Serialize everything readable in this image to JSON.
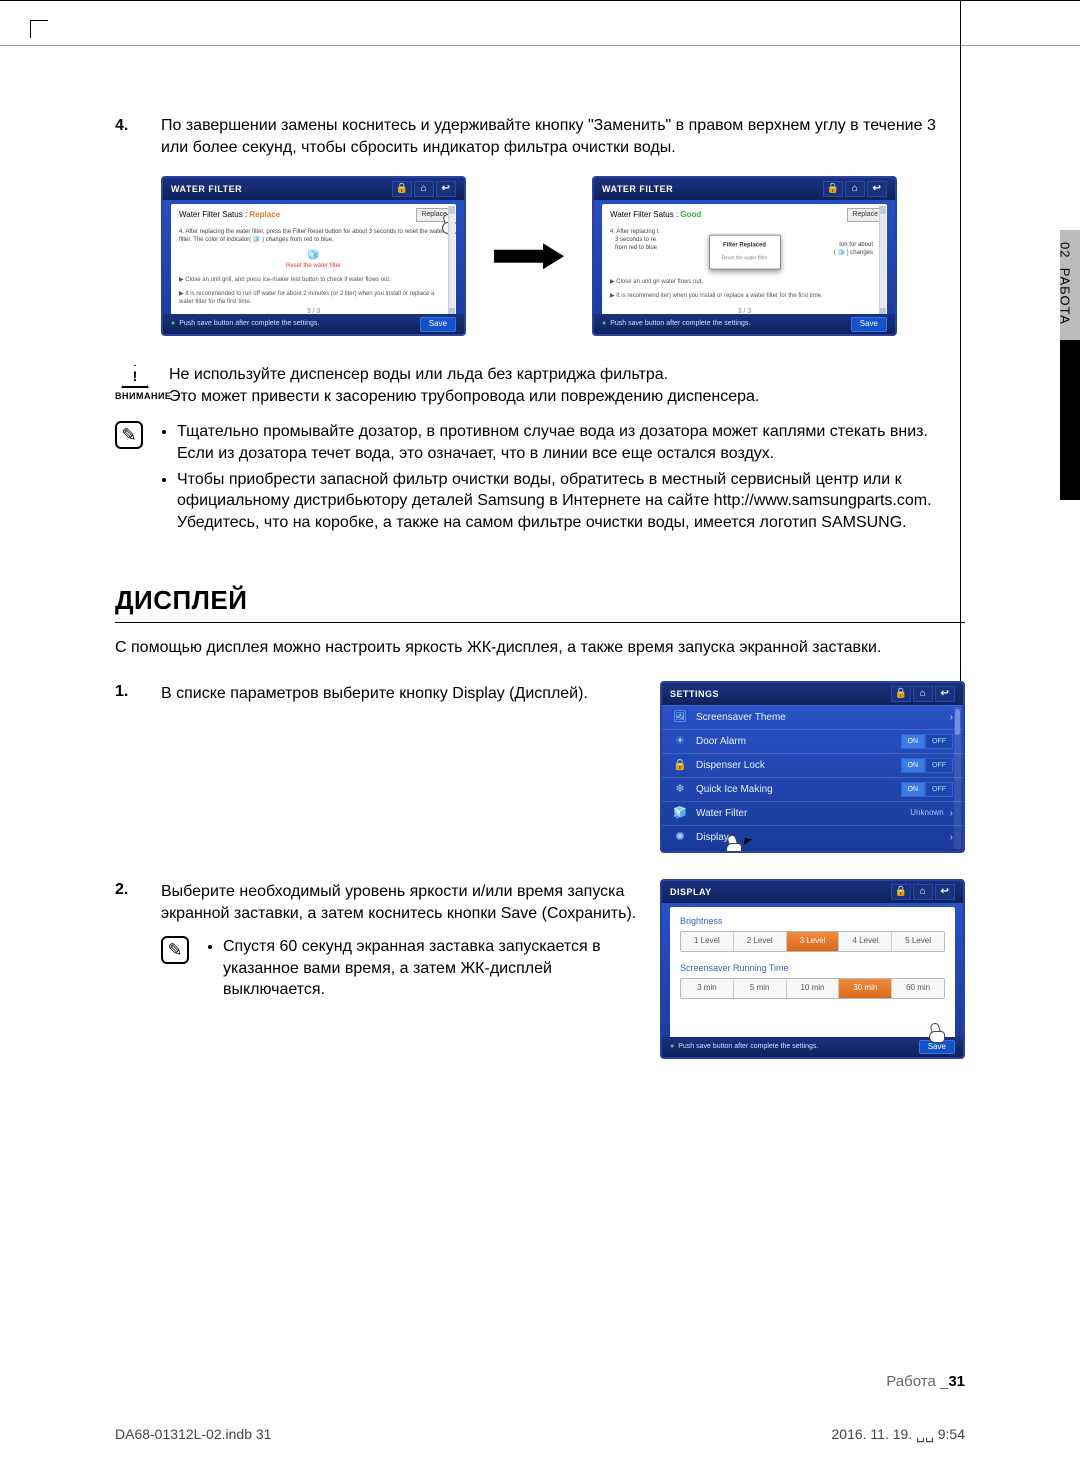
{
  "sideTab": {
    "chapterNum": "02",
    "chapterTitle": "РАБОТА"
  },
  "step4": {
    "num": "4.",
    "text": "По завершении замены коснитесь и удерживайте кнопку \"Заменить\" в правом верхнем углу в течение 3 или более секунд, чтобы сбросить индикатор фильтра очистки воды."
  },
  "screenA": {
    "title": "WATER FILTER",
    "statusLabel": "Water Filter Satus :",
    "statusValue": "Replace",
    "replaceBtn": "Replace",
    "instr": "4. After replacing the water filter, press the Filter Reset button for about 3 seconds to reset the water filter. The color of indicator( 🧊 ) changes from red to blue.",
    "resetLabel": "Reset the water filter",
    "tip1": "▶ Close an unit grill, and press ice-maker test button to check if water flows out.",
    "tip2": "▶ It is recommended to run off water for about 2 minutes (or 2 liter) when you install or replace a water filter for the first time.",
    "pager": "3 / 3",
    "footTip": "Push save button after complete the settings.",
    "save": "Save"
  },
  "screenB": {
    "title": "WATER FILTER",
    "statusLabel": "Water Filter Satus :",
    "statusValue": "Good",
    "replaceBtn": "Replace",
    "popupTitle": "Filter Replaced",
    "popupSub": "Reset the water filter",
    "instrL": "4. After replacing t\n   3 seconds to re\n   from red to blue",
    "instrR": "ton for about\n( 🧊 ) changes",
    "tip1": "▶ Close an unit gri                                               water flows out.",
    "tip2": "▶ It is recommend                                          iter) when you install or replace a water filter for the first time.",
    "pager": "3 / 3",
    "footTip": "Push save button after complete the settings.",
    "save": "Save"
  },
  "warning": {
    "label": "ВНИМАНИЕ",
    "line1": "Не используйте диспенсер воды или льда без картриджа фильтра.",
    "line2": "Это может привести к засорению трубопровода или повреждению диспенсера."
  },
  "note1": {
    "b1": "Тщательно промывайте дозатор, в противном случае вода из дозатора может каплями стекать вниз. Если из дозатора течет вода, это означает, что в линии все еще остался воздух.",
    "b2": "Чтобы приобрести запасной фильтр очистки воды, обратитесь в местный сервисный центр или к официальному дистрибьютору деталей Samsung в Интернете на сайте http://www.samsungparts.com.",
    "b2b": "Убедитесь, что на коробке, а также на самом фильтре очистки воды, имеется логотип SAMSUNG."
  },
  "displaySection": {
    "heading": "ДИСПЛЕЙ",
    "intro": "С помощью дисплея можно настроить яркость ЖК-дисплея, а также время запуска экранной заставки."
  },
  "step1": {
    "num": "1.",
    "text": "В списке параметров выберите кнопку Display (Дисплей)."
  },
  "settingsScreen": {
    "title": "SETTINGS",
    "rows": [
      {
        "icon": "🖼",
        "label": "Screensaver Theme",
        "type": "arrow"
      },
      {
        "icon": "☀",
        "label": "Door Alarm",
        "type": "toggle",
        "on": "ON",
        "off": "OFF"
      },
      {
        "icon": "🔒",
        "label": "Dispenser Lock",
        "type": "toggle",
        "on": "ON",
        "off": "OFF"
      },
      {
        "icon": "❄",
        "label": "Quick Ice Making",
        "type": "toggle",
        "on": "ON",
        "off": "OFF"
      },
      {
        "icon": "🧊",
        "label": "Water Filter",
        "type": "value",
        "value": "Unknown"
      },
      {
        "icon": "✺",
        "label": "Display",
        "type": "arrow"
      }
    ]
  },
  "step2": {
    "num": "2.",
    "text": "Выберите необходимый уровень яркости и/или время запуска экранной заставки, а затем коснитесь кнопки Save (Сохранить)."
  },
  "note2": {
    "text": "Спустя 60 секунд экранная заставка запускается в указанное вами время, а затем ЖК-дисплей выключается."
  },
  "displayScreen": {
    "title": "DISPLAY",
    "brightnessLabel": "Brightness",
    "brightness": [
      "1 Level",
      "2 Level",
      "3 Level",
      "4 Level",
      "5 Level"
    ],
    "brightnessSel": 2,
    "screensaverLabel": "Screensaver Running Time",
    "screensaver": [
      "3 min",
      "5 min",
      "10 min",
      "30 min",
      "60 min"
    ],
    "screensaverSel": 3,
    "footTip": "Push save button after complete the settings.",
    "save": "Save"
  },
  "footer": {
    "left": "DA68-01312L-02.indb   31",
    "midLabel": "Работа _",
    "midPage": "31",
    "right": "2016. 11. 19.   ␣␣ 9:54"
  }
}
